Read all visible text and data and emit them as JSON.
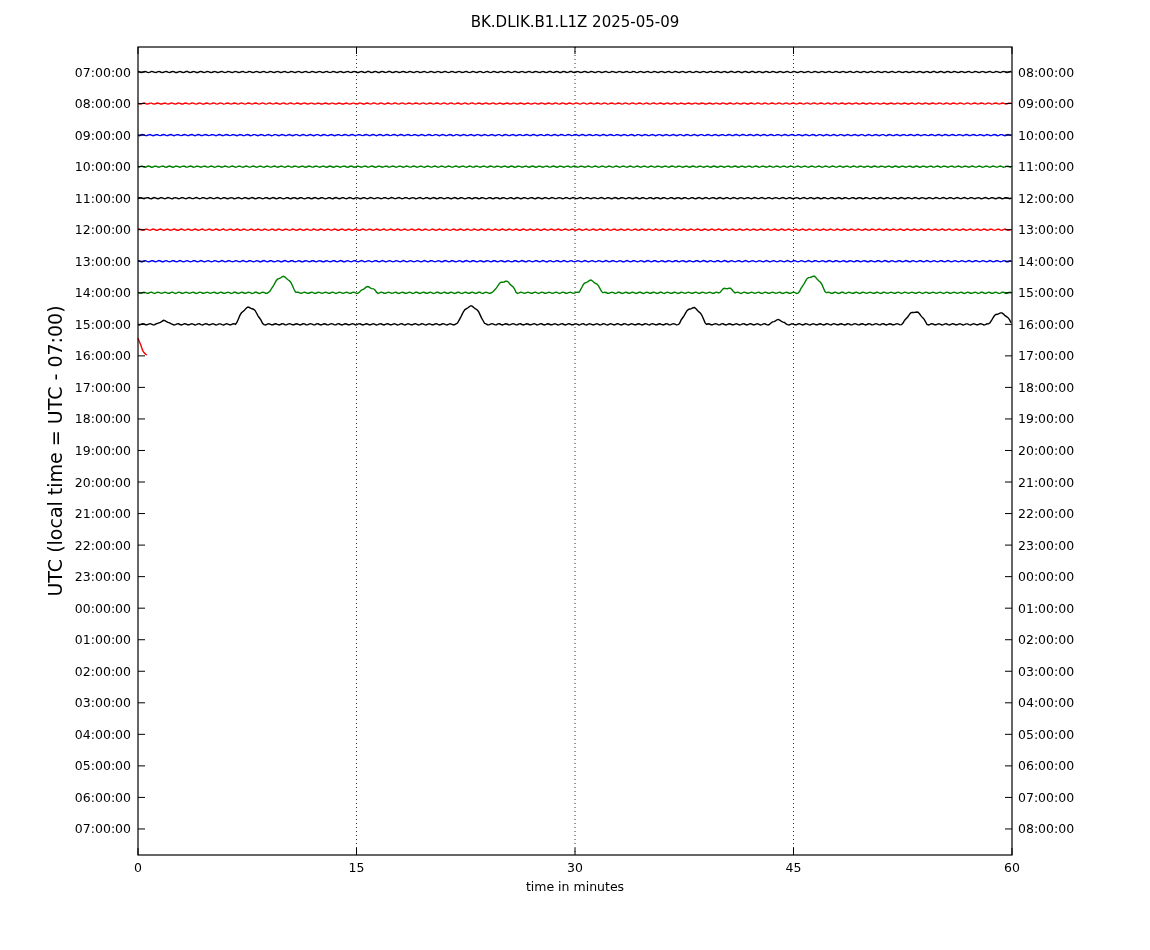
{
  "title": "BK.DLIK.B1.L1Z 2025-05-09",
  "xlabel": "time in minutes",
  "ylabel": "UTC (local time = UTC - 07:00)",
  "xticks": [
    "0",
    "15",
    "30",
    "45",
    "60"
  ],
  "left_labels": [
    "07:00:00",
    "08:00:00",
    "09:00:00",
    "10:00:00",
    "11:00:00",
    "12:00:00",
    "13:00:00",
    "14:00:00",
    "15:00:00",
    "16:00:00",
    "17:00:00",
    "18:00:00",
    "19:00:00",
    "20:00:00",
    "21:00:00",
    "22:00:00",
    "23:00:00",
    "00:00:00",
    "01:00:00",
    "02:00:00",
    "03:00:00",
    "04:00:00",
    "05:00:00",
    "06:00:00",
    "07:00:00"
  ],
  "right_labels": [
    "08:00:00",
    "09:00:00",
    "10:00:00",
    "11:00:00",
    "12:00:00",
    "13:00:00",
    "14:00:00",
    "15:00:00",
    "16:00:00",
    "17:00:00",
    "18:00:00",
    "19:00:00",
    "20:00:00",
    "21:00:00",
    "22:00:00",
    "23:00:00",
    "00:00:00",
    "01:00:00",
    "02:00:00",
    "03:00:00",
    "04:00:00",
    "05:00:00",
    "06:00:00",
    "07:00:00",
    "08:00:00"
  ],
  "traces": [
    {
      "color": "#000000",
      "level": 1
    },
    {
      "color": "#ff0000",
      "level": 1
    },
    {
      "color": "#0000ff",
      "level": 1
    },
    {
      "color": "#008000",
      "level": 1
    },
    {
      "color": "#000000",
      "level": 1
    },
    {
      "color": "#ff0000",
      "level": 1
    },
    {
      "color": "#0000ff",
      "level": 1
    },
    {
      "color": "#008000",
      "level": 1
    },
    {
      "color": "#000000",
      "level": 1
    },
    {
      "color": "#ff0000",
      "level": 0.012
    }
  ]
}
